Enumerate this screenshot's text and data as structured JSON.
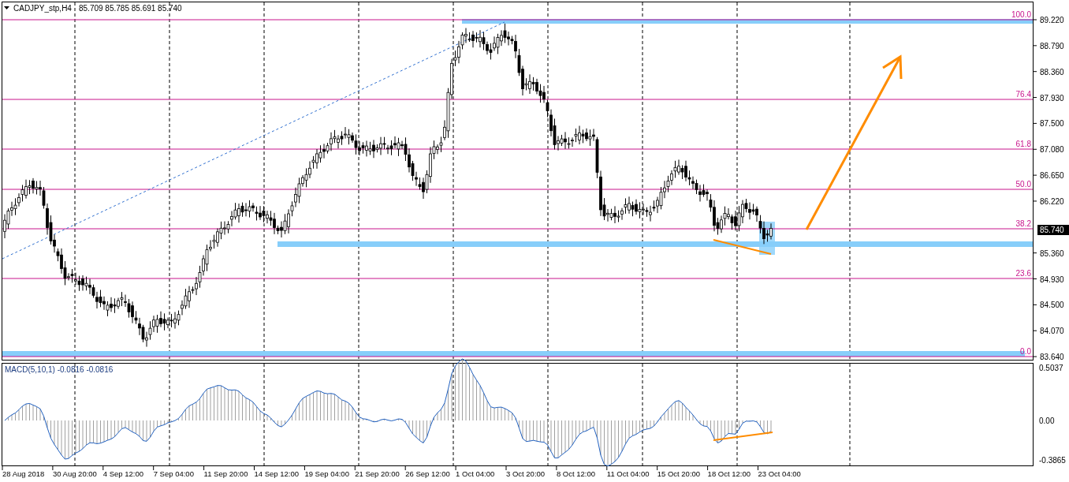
{
  "chart_header": {
    "symbol": "CADJPY_stp,H4",
    "ohlc": "85.709 85.785 85.691 85.740"
  },
  "price_axis": [
    "89.220",
    "88.790",
    "88.360",
    "87.930",
    "87.500",
    "87.080",
    "86.650",
    "86.220",
    "85.360",
    "84.930",
    "84.500",
    "84.070",
    "83.640"
  ],
  "current_price": "85.740",
  "fib_levels": [
    "100.0",
    "76.4",
    "61.8",
    "50.0",
    "38.2",
    "23.6",
    "0.0"
  ],
  "macd_header": "MACD(5,10,1) -0.0816 -0.0816",
  "macd_axis": [
    "0.5037",
    "0.00",
    "-0.3865"
  ],
  "time_axis": [
    "28 Aug 2018",
    "30 Aug 20:00",
    "4 Sep 12:00",
    "7 Sep 04:00",
    "11 Sep 20:00",
    "14 Sep 12:00",
    "19 Sep 04:00",
    "21 Sep 20:00",
    "26 Sep 12:00",
    "1 Oct 04:00",
    "3 Oct 20:00",
    "8 Oct 12:00",
    "11 Oct 04:00",
    "15 Oct 20:00",
    "18 Oct 12:00",
    "23 Oct 04:00"
  ]
}
